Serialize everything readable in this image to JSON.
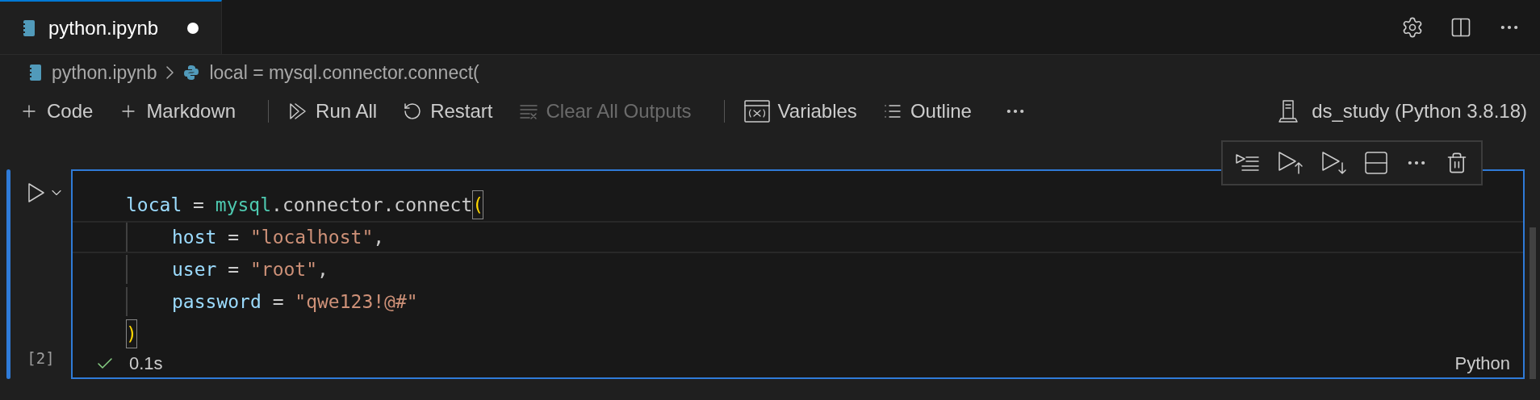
{
  "tabs": [
    {
      "label": "python.ipynb",
      "selected": true,
      "modified": true
    }
  ],
  "breadcrumbs": [
    {
      "kind": "notebook",
      "label": "python.ipynb"
    },
    {
      "kind": "python",
      "label": "local = mysql.connector.connect("
    }
  ],
  "toolbar": [
    {
      "kind": "add",
      "label": "Code",
      "disabled": false
    },
    {
      "kind": "add",
      "label": "Markdown",
      "disabled": false
    },
    {
      "kind": "separator"
    },
    {
      "kind": "run-all",
      "label": "Run All",
      "disabled": false
    },
    {
      "kind": "restart",
      "label": "Restart",
      "disabled": false
    },
    {
      "kind": "clear",
      "label": "Clear All Outputs",
      "disabled": true
    },
    {
      "kind": "separator"
    },
    {
      "kind": "variables",
      "label": "Variables",
      "disabled": false
    },
    {
      "kind": "outline",
      "label": "Outline",
      "disabled": false
    },
    {
      "kind": "more"
    }
  ],
  "kernel": "ds_study (Python 3.8.18)",
  "cell": {
    "selected": true,
    "execution_count": "[2]",
    "status": "0.1s",
    "succeeded": true,
    "language": "Python",
    "lines": [
      {
        "indented": false,
        "current": false,
        "tokens": [
          {
            "kind": "variable",
            "text": "local"
          },
          {
            "kind": "plain",
            "text": " = "
          },
          {
            "kind": "module",
            "text": "mysql"
          },
          {
            "kind": "plain",
            "text": ".connector.connect"
          },
          {
            "kind": "bracket-match",
            "text": "("
          }
        ]
      },
      {
        "indented": true,
        "current": true,
        "tokens": [
          {
            "kind": "variable",
            "text": "host"
          },
          {
            "kind": "plain",
            "text": " = "
          },
          {
            "kind": "string",
            "text": "\"localhost\""
          },
          {
            "kind": "plain",
            "text": ","
          }
        ]
      },
      {
        "indented": true,
        "current": false,
        "tokens": [
          {
            "kind": "variable",
            "text": "user"
          },
          {
            "kind": "plain",
            "text": " = "
          },
          {
            "kind": "string",
            "text": "\"root\""
          },
          {
            "kind": "plain",
            "text": ","
          }
        ]
      },
      {
        "indented": true,
        "current": false,
        "tokens": [
          {
            "kind": "variable",
            "text": "password"
          },
          {
            "kind": "plain",
            "text": " = "
          },
          {
            "kind": "string",
            "text": "\"qwe123!@#\""
          }
        ]
      },
      {
        "indented": false,
        "current": false,
        "tokens": [
          {
            "kind": "bracket-match",
            "text": ")"
          }
        ]
      }
    ]
  }
}
